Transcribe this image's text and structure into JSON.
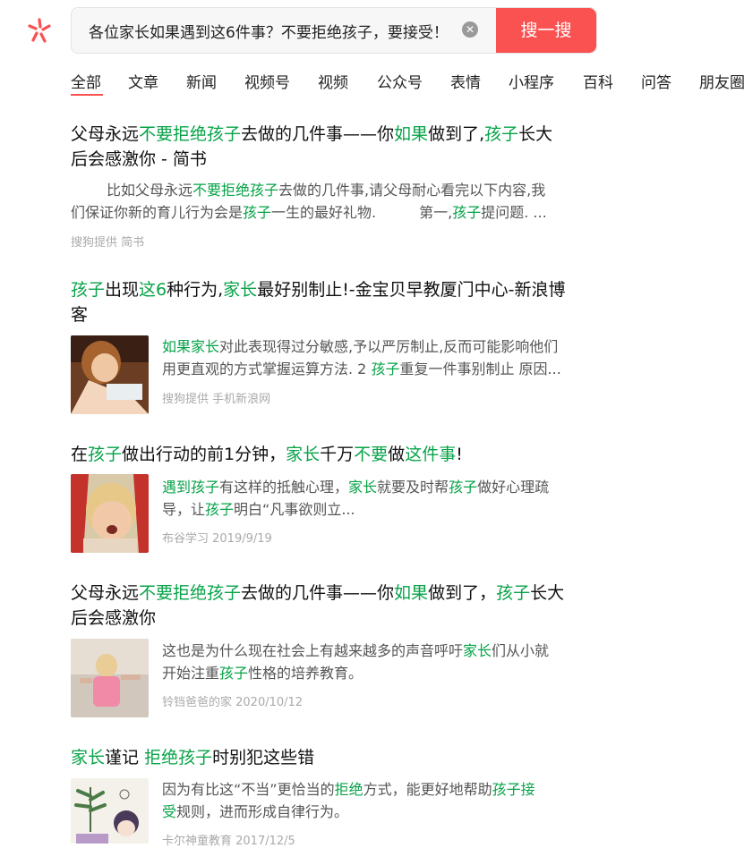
{
  "search": {
    "query": "各位家长如果遇到这6件事？不要拒绝孩子，要接受！",
    "button": "搜一搜"
  },
  "tabs": [
    "全部",
    "文章",
    "新闻",
    "视频号",
    "视频",
    "公众号",
    "表情",
    "小程序",
    "百科",
    "问答",
    "朋友圈"
  ],
  "results": [
    {
      "title_line1": [
        [
          "父母永远",
          0
        ],
        [
          "不要拒绝孩子",
          1
        ],
        [
          "去做的几件事——你",
          0
        ],
        [
          "如果",
          1
        ],
        [
          "做到了,",
          0
        ],
        [
          "孩子",
          1
        ],
        [
          "长大",
          0
        ]
      ],
      "title_line2": [
        [
          "后会感激你 - 简书",
          0
        ]
      ],
      "snippet_line1": [
        [
          "比如父母永远",
          0
        ],
        [
          "不要拒绝孩子",
          1
        ],
        [
          "去做的几件事,请父母耐心看完以下内容,我",
          0
        ]
      ],
      "snippet_line2": [
        [
          "们保证你新的育儿行为会是",
          0
        ],
        [
          "孩子",
          1
        ],
        [
          "一生的最好礼物.　　　第一,",
          0
        ],
        [
          "孩子",
          1
        ],
        [
          "提问题. ...",
          0
        ]
      ],
      "meta": "搜狗提供 简书"
    },
    {
      "title_line1": [
        [
          "孩子",
          1
        ],
        [
          "出现",
          0
        ],
        [
          "这6",
          1
        ],
        [
          "种行为,",
          0
        ],
        [
          "家长",
          1
        ],
        [
          "最好别制止!-金宝贝早教厦门中心-新浪博",
          0
        ]
      ],
      "title_line2": [
        [
          "客",
          0
        ]
      ],
      "snippet_line1": [
        [
          "如果家长",
          1
        ],
        [
          "对此表现得过分敏感,予以严厉制止,反而可能影响他们",
          0
        ]
      ],
      "snippet_line2": [
        [
          "用更直观的方式掌握运算方法. 2 ",
          0
        ],
        [
          "孩子",
          1
        ],
        [
          "重复一件事别制止 原因...",
          0
        ]
      ],
      "meta": "搜狗提供 手机新浪网"
    },
    {
      "title_line1": [
        [
          "在",
          0
        ],
        [
          "孩子",
          1
        ],
        [
          "做出行动的前1分钟，",
          0
        ],
        [
          "家长",
          1
        ],
        [
          "千万",
          0
        ],
        [
          "不要",
          1
        ],
        [
          "做",
          0
        ],
        [
          "这件事",
          1
        ],
        [
          "!",
          0
        ]
      ],
      "snippet_line1": [
        [
          "遇到孩子",
          1
        ],
        [
          "有这样的抵触心理，",
          0
        ],
        [
          "家长",
          1
        ],
        [
          "就要及时帮",
          0
        ],
        [
          "孩子",
          1
        ],
        [
          "做好心理疏",
          0
        ]
      ],
      "snippet_line2": [
        [
          "导，让",
          0
        ],
        [
          "孩子",
          1
        ],
        [
          "明白“凡事欲则立...",
          0
        ]
      ],
      "meta": "布谷学习   2019/9/19"
    },
    {
      "title_line1": [
        [
          "父母永远",
          0
        ],
        [
          "不要拒绝孩子",
          1
        ],
        [
          "去做的几件事——你",
          0
        ],
        [
          "如果",
          1
        ],
        [
          "做到了，",
          0
        ],
        [
          "孩子",
          1
        ],
        [
          "长大",
          0
        ]
      ],
      "title_line2": [
        [
          "后会感激你",
          0
        ]
      ],
      "snippet_line1": [
        [
          "这也是为什么现在社会上有越来越多的声音呼吁",
          0
        ],
        [
          "家长",
          1
        ],
        [
          "们从小就",
          0
        ]
      ],
      "snippet_line2": [
        [
          "开始注重",
          0
        ],
        [
          "孩子",
          1
        ],
        [
          "性格的培养教育。",
          0
        ]
      ],
      "meta": "铃铛爸爸的家   2020/10/12"
    },
    {
      "title_line1": [
        [
          "家长",
          1
        ],
        [
          "谨记 ",
          0
        ],
        [
          "拒绝孩子",
          1
        ],
        [
          "时别犯这些错",
          0
        ]
      ],
      "snippet_line1": [
        [
          "因为有比这“不当”更恰当的",
          0
        ],
        [
          "拒绝",
          1
        ],
        [
          "方式，能更好地帮助",
          0
        ],
        [
          "孩子接",
          1
        ]
      ],
      "snippet_line2": [
        [
          "受",
          1
        ],
        [
          "规则，进而形成自律行为。",
          0
        ]
      ],
      "meta": "卡尔神童教育   2017/12/5"
    }
  ],
  "colors": {
    "accent": "#fa5151",
    "highlight": "#07a348"
  }
}
